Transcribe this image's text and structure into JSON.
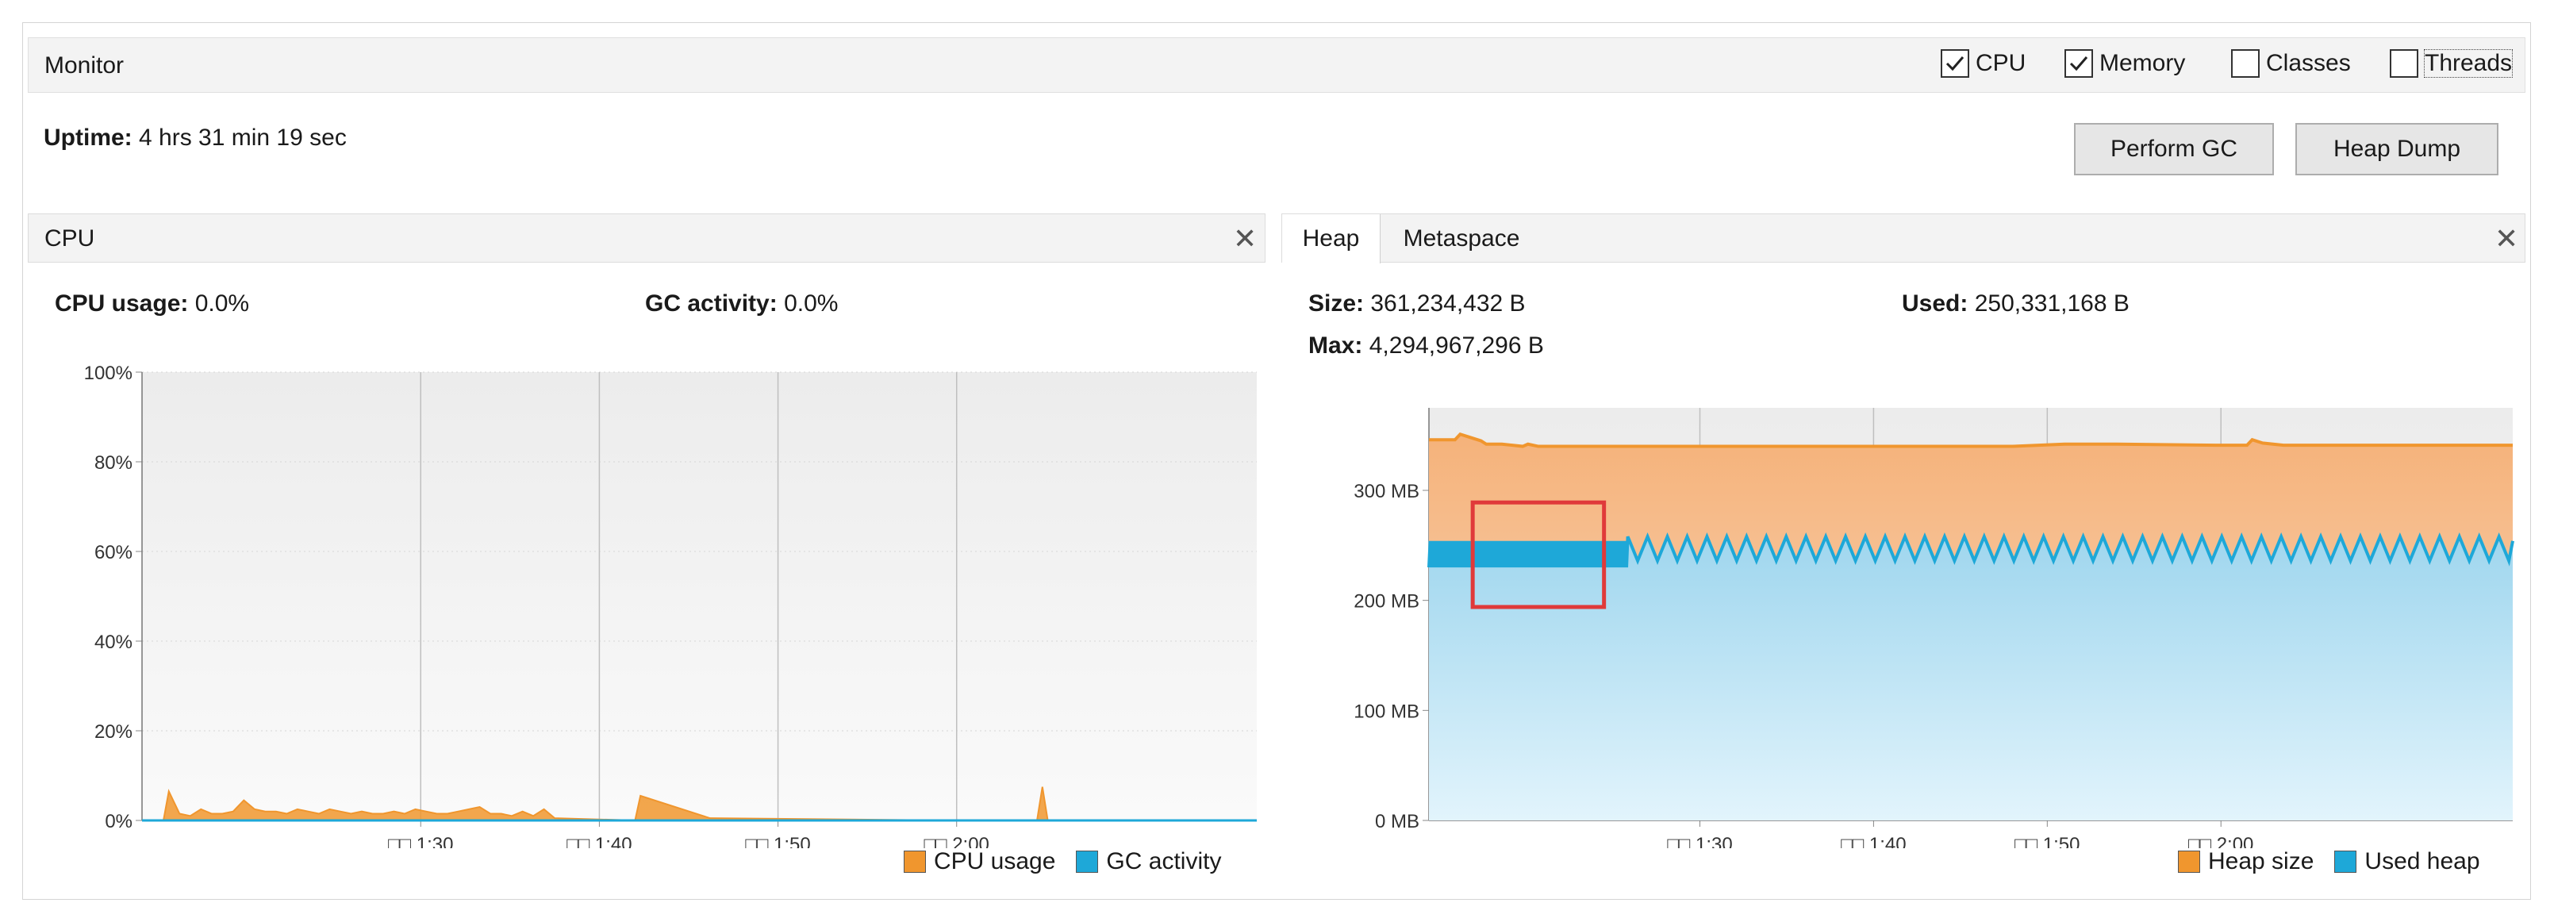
{
  "monitor": {
    "title": "Monitor",
    "checkboxes": [
      {
        "label": "CPU",
        "checked": true
      },
      {
        "label": "Memory",
        "checked": true
      },
      {
        "label": "Classes",
        "checked": false
      },
      {
        "label": "Threads",
        "checked": false
      }
    ],
    "uptime_label": "Uptime:",
    "uptime_value": "4 hrs 31 min 19 sec",
    "buttons": {
      "perform_gc": "Perform GC",
      "heap_dump": "Heap Dump"
    }
  },
  "cpu_panel": {
    "title": "CPU",
    "close_icon": "close-icon",
    "cpu_usage_label": "CPU usage:",
    "cpu_usage_value": "0.0%",
    "gc_activity_label": "GC activity:",
    "gc_activity_value": "0.0%",
    "legend": [
      {
        "label": "CPU usage",
        "color": "#f0962e"
      },
      {
        "label": "GC activity",
        "color": "#1ea8d8"
      }
    ]
  },
  "heap_panel": {
    "tabs": [
      "Heap",
      "Metaspace"
    ],
    "active_tab": "Heap",
    "size_label": "Size:",
    "size_value": "361,234,432 B",
    "used_label": "Used:",
    "used_value": "250,331,168 B",
    "max_label": "Max:",
    "max_value": "4,294,967,296 B",
    "legend": [
      {
        "label": "Heap size",
        "color": "#f0962e"
      },
      {
        "label": "Used heap",
        "color": "#1ea8d8"
      }
    ],
    "highlight_color": "#e03a3a"
  },
  "chart_data": [
    {
      "type": "area",
      "title": "",
      "xlabel": "",
      "ylabel": "",
      "y_ticks": [
        "0%",
        "20%",
        "40%",
        "60%",
        "80%",
        "100%"
      ],
      "x_ticks": [
        "□□ 1:30",
        "□□ 1:40",
        "□□ 1:50",
        "□□ 2:00"
      ],
      "ylim": [
        0,
        100
      ],
      "grid": true,
      "legend_placement": "bottom-right",
      "series": [
        {
          "name": "CPU usage",
          "color": "#f0962e",
          "x": [
            1.24,
            1.26,
            1.265,
            1.275,
            1.285,
            1.295,
            1.305,
            1.315,
            1.325,
            1.335,
            1.345,
            1.355,
            1.365,
            1.375,
            1.385,
            1.395,
            1.405,
            1.415,
            1.425,
            1.435,
            1.445,
            1.455,
            1.465,
            1.475,
            1.485,
            1.495,
            1.505,
            1.515,
            1.525,
            1.535,
            1.545,
            1.555,
            1.565,
            1.575,
            1.585,
            1.595,
            1.605,
            1.615,
            1.625,
            1.7,
            1.705,
            1.77,
            1.86,
            2.0,
            2.075,
            2.08,
            2.085,
            2.28
          ],
          "values": [
            0,
            0,
            6.5,
            1.5,
            1.0,
            2.5,
            1.5,
            1.5,
            2.0,
            4.5,
            2.5,
            2.0,
            2.0,
            1.5,
            2.5,
            2.0,
            1.5,
            2.5,
            2.0,
            1.5,
            2.0,
            1.5,
            1.5,
            2.0,
            1.5,
            2.5,
            2.0,
            1.5,
            1.5,
            2.0,
            2.5,
            3.0,
            1.5,
            1.5,
            1.0,
            2.0,
            1.0,
            2.5,
            0.5,
            0,
            5.5,
            0.5,
            0.3,
            0,
            0,
            7.5,
            0,
            0
          ]
        },
        {
          "name": "GC activity",
          "color": "#1ea8d8",
          "x": [
            1.24,
            2.28
          ],
          "values": [
            0,
            0
          ]
        }
      ]
    },
    {
      "type": "area",
      "title": "",
      "xlabel": "",
      "ylabel": "",
      "y_ticks": [
        "0 MB",
        "100 MB",
        "200 MB",
        "300 MB"
      ],
      "x_ticks": [
        "□□ 1:30",
        "□□ 1:40",
        "□□ 1:50",
        "□□ 2:00"
      ],
      "ylim": [
        0,
        375
      ],
      "grid": true,
      "legend_placement": "bottom-right",
      "series": [
        {
          "name": "Heap size",
          "color": "#f0962e",
          "x": [
            1.24,
            1.265,
            1.27,
            1.28,
            1.29,
            1.295,
            1.31,
            1.33,
            1.335,
            1.345,
            1.4,
            1.5,
            1.6,
            1.8,
            1.85,
            1.9,
            1.995,
            2.025,
            2.03,
            2.04,
            2.06,
            2.28
          ],
          "values": [
            346,
            346,
            351,
            348,
            345,
            342,
            342,
            340,
            342,
            340,
            340,
            340,
            340,
            340,
            342,
            342,
            341,
            341,
            346,
            343,
            341,
            341
          ]
        },
        {
          "name": "Used heap",
          "color": "#1ea8d8",
          "sawtooth": {
            "x_start": 1.24,
            "x_end": 2.28,
            "dense_until": 1.43,
            "low": 226,
            "high": 258
          },
          "values": [
            238,
            250,
            228,
            255,
            230,
            256,
            228,
            255,
            226,
            254,
            235,
            256,
            240,
            252
          ]
        }
      ]
    }
  ]
}
